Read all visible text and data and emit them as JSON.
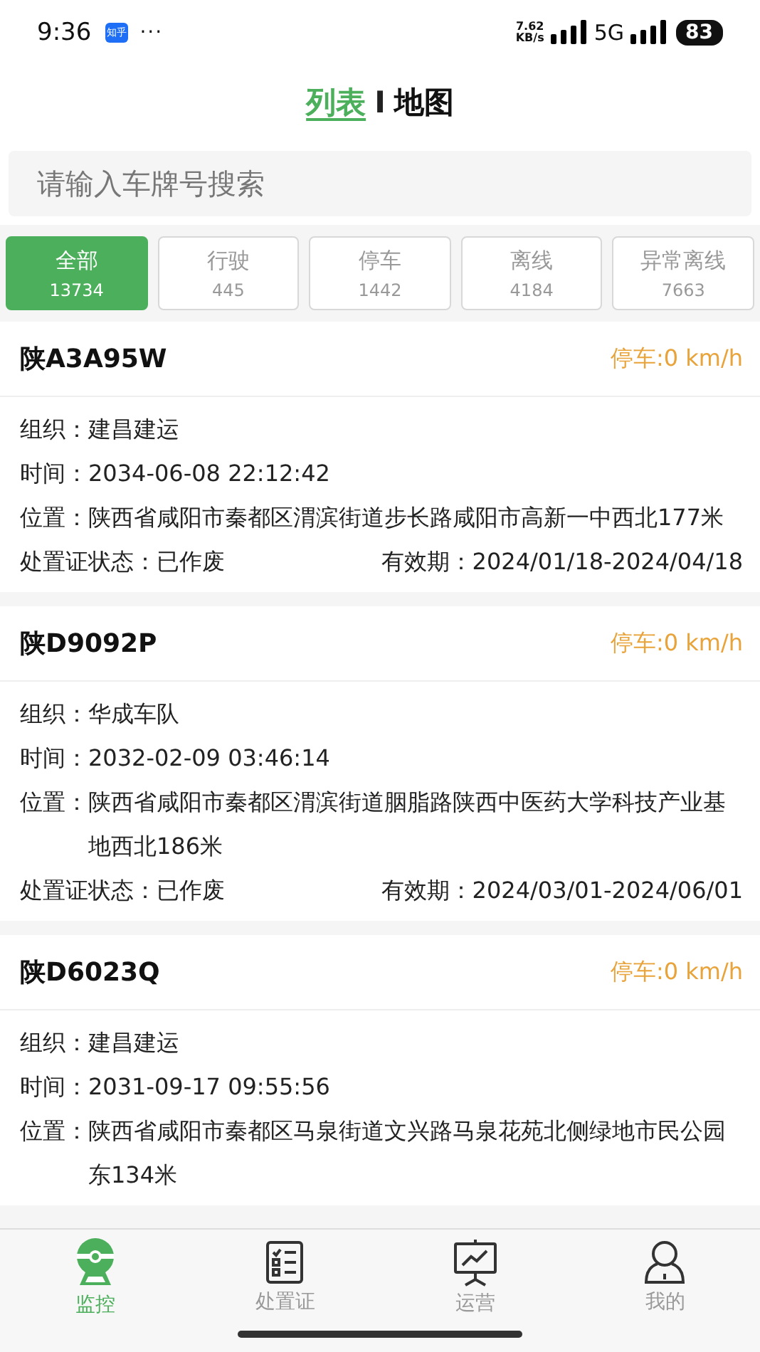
{
  "status_bar": {
    "time": "9:36",
    "app_badge": "知乎",
    "more": "···",
    "speed": "7.62",
    "speed_unit": "KB/s",
    "network": "5G",
    "battery": "83"
  },
  "header": {
    "tabs": [
      {
        "label": "列表",
        "selected": true
      },
      {
        "label": "地图",
        "selected": false
      }
    ],
    "separator": "I"
  },
  "search": {
    "placeholder": "请输入车牌号搜索"
  },
  "filters": [
    {
      "label": "全部",
      "count": "13734",
      "selected": true
    },
    {
      "label": "行驶",
      "count": "445",
      "selected": false
    },
    {
      "label": "停车",
      "count": "1442",
      "selected": false
    },
    {
      "label": "离线",
      "count": "4184",
      "selected": false
    },
    {
      "label": "异常离线",
      "count": "7663",
      "selected": false
    }
  ],
  "vehicles": [
    {
      "plate": "陕A3A95W",
      "status": "停车:0 km/h",
      "details": [
        {
          "label": "组织：",
          "value": "建昌建运"
        },
        {
          "label": "时间：",
          "value": "2034-06-08 22:12:42"
        },
        {
          "label": "位置：",
          "value": "陕西省咸阳市秦都区渭滨街道步长路咸阳市高新一中西北177米"
        }
      ],
      "footer": {
        "cert_label": "处置证状态：",
        "cert_value": "已作废",
        "validity_label": "有效期：",
        "validity_value": "2024/01/18-2024/04/18"
      }
    },
    {
      "plate": "陕D9092P",
      "status": "停车:0 km/h",
      "details": [
        {
          "label": "组织：",
          "value": "华成车队"
        },
        {
          "label": "时间：",
          "value": "2032-02-09 03:46:14"
        },
        {
          "label": "位置：",
          "value": "陕西省咸阳市秦都区渭滨街道胭脂路陕西中医药大学科技产业基地西北186米"
        }
      ],
      "footer": {
        "cert_label": "处置证状态：",
        "cert_value": "已作废",
        "validity_label": "有效期：",
        "validity_value": "2024/03/01-2024/06/01"
      }
    },
    {
      "plate": "陕D6023Q",
      "status": "停车:0 km/h",
      "details": [
        {
          "label": "组织：",
          "value": "建昌建运"
        },
        {
          "label": "时间：",
          "value": "2031-09-17 09:55:56"
        },
        {
          "label": "位置：",
          "value": "陕西省咸阳市秦都区马泉街道文兴路马泉花苑北侧绿地市民公园东134米"
        }
      ]
    }
  ],
  "tab_bar": [
    {
      "kind": "monitor",
      "label": "监控",
      "selected": true
    },
    {
      "kind": "checklist",
      "label": "处置证",
      "selected": false
    },
    {
      "kind": "chart",
      "label": "运营",
      "selected": false
    },
    {
      "kind": "person",
      "label": "我的",
      "selected": false
    }
  ]
}
